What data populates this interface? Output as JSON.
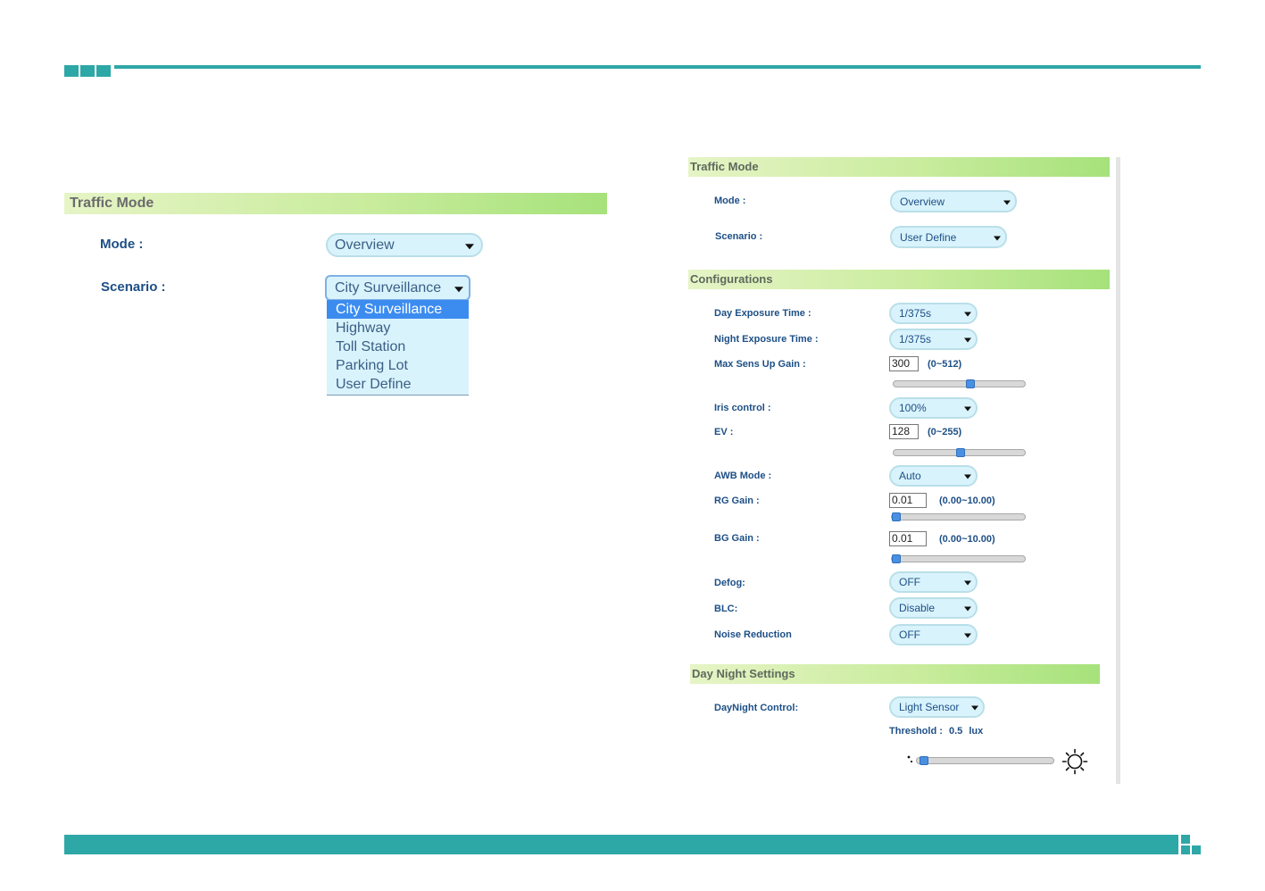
{
  "left": {
    "header": "Traffic Mode",
    "mode_label": "Mode :",
    "mode_value": "Overview",
    "scenario_label": "Scenario :",
    "scenario_value": "City Surveillance",
    "scenario_options": [
      "City Surveillance",
      "Highway",
      "Toll Station",
      "Parking Lot",
      "User Define"
    ]
  },
  "right": {
    "traffic_header": "Traffic Mode",
    "mode_label": "Mode :",
    "mode_value": "Overview",
    "scenario_label": "Scenario :",
    "scenario_value": "User Define",
    "config_header": "Configurations",
    "day_exposure_label": "Day Exposure Time :",
    "day_exposure_value": "1/375s",
    "night_exposure_label": "Night Exposure Time :",
    "night_exposure_value": "1/375s",
    "max_gain_label": "Max Sens Up Gain :",
    "max_gain_value": "300",
    "max_gain_range": "(0~512)",
    "max_gain_slider": 0.586,
    "iris_label": "Iris control :",
    "iris_value": "100%",
    "ev_label": "EV :",
    "ev_value": "128",
    "ev_range": "(0~255)",
    "ev_slider": 0.502,
    "awb_label": "AWB Mode :",
    "awb_value": "Auto",
    "rg_label": "RG Gain :",
    "rg_value": "0.01",
    "rg_range": "(0.00~10.00)",
    "rg_slider": 0.001,
    "bg_label": "BG Gain :",
    "bg_value": "0.01",
    "bg_range": "(0.00~10.00)",
    "bg_slider": 0.001,
    "defog_label": "Defog:",
    "defog_value": "OFF",
    "blc_label": "BLC:",
    "blc_value": "Disable",
    "nr_label": "Noise Reduction",
    "nr_value": "OFF",
    "daynight_header": "Day Night Settings",
    "daynight_label": "DayNight Control:",
    "daynight_value": "Light Sensor",
    "threshold_label": "Threshold :",
    "threshold_value": "0.5",
    "threshold_unit": "lux",
    "threshold_slider": 0.02
  },
  "icons": {
    "night": "moon-icon",
    "day": "sun-icon"
  },
  "colors": {
    "accent": "#2ea7a7",
    "select_bg": "#d9f3fc",
    "selected_option": "#3c8cf0",
    "label_text": "#1d4f86"
  }
}
